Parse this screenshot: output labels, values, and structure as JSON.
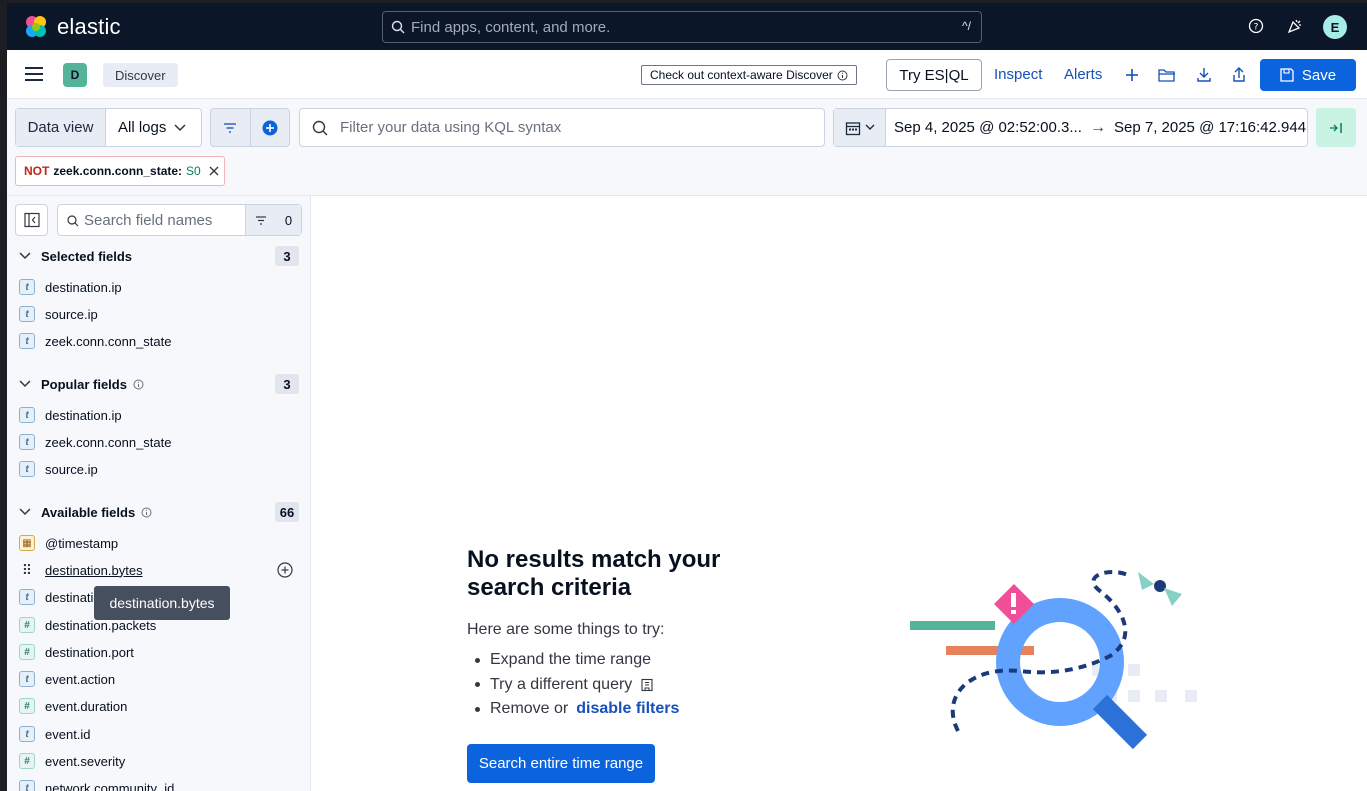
{
  "header": {
    "brand": "elastic",
    "search_placeholder": "Find apps, content, and more.",
    "search_shortcut": "^/",
    "avatar_initial": "E"
  },
  "appbar": {
    "space_initial": "D",
    "breadcrumb": "Discover",
    "context_aware_label": "Check out context-aware Discover",
    "try_esql_label": "Try ES|QL",
    "inspect_label": "Inspect",
    "alerts_label": "Alerts",
    "save_label": "Save"
  },
  "querybar": {
    "data_view_label": "Data view",
    "data_view_value": "All logs",
    "kql_placeholder": "Filter your data using KQL syntax",
    "date_start": "Sep 4, 2025 @ 02:52:00.3...",
    "date_end": "Sep 7, 2025 @ 17:16:42.944",
    "filter_pill": {
      "negation": "NOT",
      "field": "zeek.conn.conn_state:",
      "value": "S0"
    }
  },
  "sidebar": {
    "search_placeholder": "Search field names",
    "filter_count": "0",
    "selected": {
      "title": "Selected fields",
      "count": "3",
      "items": [
        {
          "name": "destination.ip",
          "type": "t"
        },
        {
          "name": "source.ip",
          "type": "t"
        },
        {
          "name": "zeek.conn.conn_state",
          "type": "t"
        }
      ]
    },
    "popular": {
      "title": "Popular fields",
      "count": "3",
      "items": [
        {
          "name": "destination.ip",
          "type": "t"
        },
        {
          "name": "zeek.conn.conn_state",
          "type": "t"
        },
        {
          "name": "source.ip",
          "type": "t"
        }
      ]
    },
    "available": {
      "title": "Available fields",
      "count": "66",
      "items": [
        {
          "name": "@timestamp",
          "type": "date"
        },
        {
          "name": "destination.bytes",
          "type": "drag"
        },
        {
          "name": "destination",
          "type": "t"
        },
        {
          "name": "destination.packets",
          "type": "#"
        },
        {
          "name": "destination.port",
          "type": "#"
        },
        {
          "name": "event.action",
          "type": "t"
        },
        {
          "name": "event.duration",
          "type": "#"
        },
        {
          "name": "event.id",
          "type": "t"
        },
        {
          "name": "event.severity",
          "type": "#"
        },
        {
          "name": "network.community_id",
          "type": "t"
        }
      ]
    },
    "tooltip": "destination.bytes"
  },
  "empty_state": {
    "title": "No results match your search criteria",
    "subtitle": "Here are some things to try:",
    "tip_1": "Expand the time range",
    "tip_2": "Try a different query",
    "tip_3_prefix": "Remove or",
    "tip_3_link": "disable filters",
    "cta_label": "Search entire time range"
  },
  "colors": {
    "header_bg": "#0b1628",
    "primary": "#0b64dd",
    "link": "#1750ba",
    "danger": "#bd271e"
  }
}
